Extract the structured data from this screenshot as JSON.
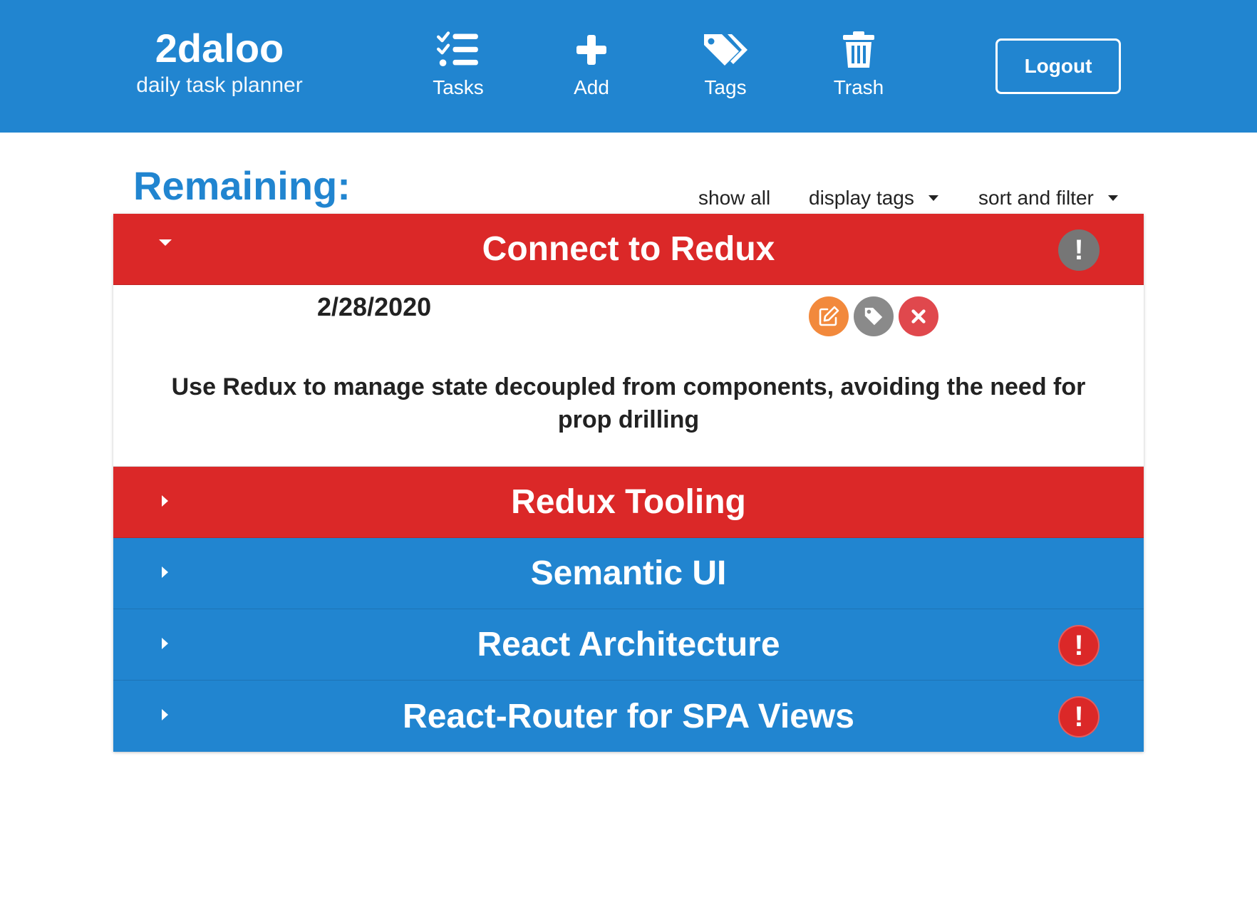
{
  "header": {
    "brand_title": "2daloo",
    "brand_subtitle": "daily task planner",
    "nav": [
      {
        "label": "Tasks",
        "icon": "tasks-icon"
      },
      {
        "label": "Add",
        "icon": "plus-icon"
      },
      {
        "label": "Tags",
        "icon": "tags-icon"
      },
      {
        "label": "Trash",
        "icon": "trash-icon"
      }
    ],
    "logout_label": "Logout"
  },
  "main": {
    "title": "Remaining:",
    "toolbar": {
      "show_all": "show all",
      "display_tags": "display tags",
      "sort_filter": "sort and filter"
    },
    "tasks": [
      {
        "title": "Connect to Redux",
        "color": "#db2828",
        "expanded": true,
        "priority_badge": "!",
        "badge_color": "#767676",
        "date": "2/28/2020",
        "description": "Use Redux to manage state decoupled from components, avoiding the need for prop drilling"
      },
      {
        "title": "Redux Tooling",
        "color": "#db2828",
        "expanded": false
      },
      {
        "title": "Semantic UI",
        "color": "#2185d0",
        "expanded": false
      },
      {
        "title": "React Architecture",
        "color": "#2185d0",
        "expanded": false,
        "priority_badge": "!",
        "badge_color": "#db2828"
      },
      {
        "title": "React-Router for SPA Views",
        "color": "#2185d0",
        "expanded": false,
        "priority_badge": "!",
        "badge_color": "#db2828"
      }
    ]
  },
  "colors": {
    "primary": "#2185d0",
    "danger": "#db2828",
    "edit": "#f2893c",
    "tag": "#8a8a8a",
    "delete": "#e0484d"
  }
}
